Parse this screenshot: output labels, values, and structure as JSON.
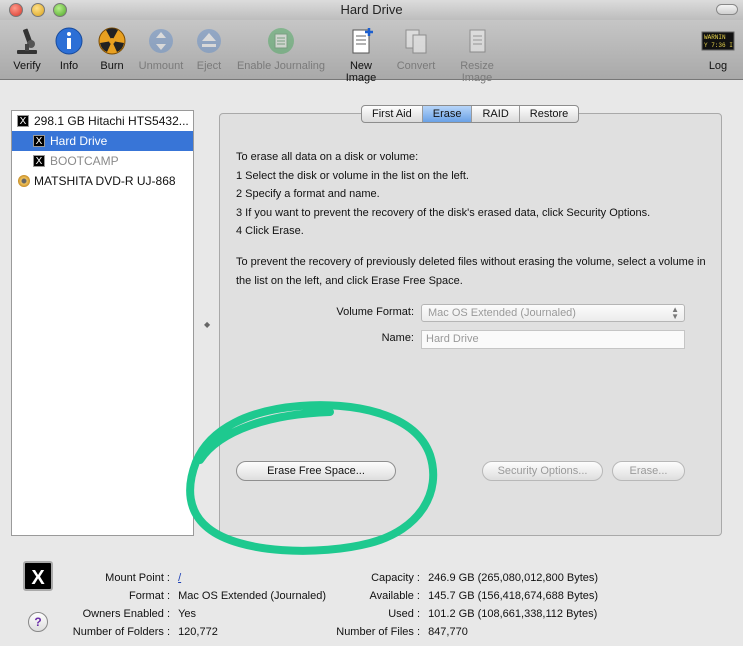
{
  "window": {
    "title": "Hard Drive"
  },
  "toolbar": {
    "items": [
      {
        "label": "Verify",
        "icon": "microscope-icon"
      },
      {
        "label": "Info",
        "icon": "info-icon"
      },
      {
        "label": "Burn",
        "icon": "burn-icon"
      },
      {
        "label": "Unmount",
        "icon": "unmount-icon"
      },
      {
        "label": "Eject",
        "icon": "eject-icon"
      },
      {
        "label": "Enable Journaling",
        "icon": "journaling-icon"
      },
      {
        "label": "New Image",
        "icon": "new-image-icon"
      },
      {
        "label": "Convert",
        "icon": "convert-icon"
      },
      {
        "label": "Resize Image",
        "icon": "resize-image-icon"
      },
      {
        "label": "Log",
        "icon": "log-icon",
        "log_text_1": "WARNIN",
        "log_text_2": "Y 7:36 I"
      }
    ]
  },
  "sidebar": {
    "items": [
      {
        "label": "298.1 GB Hitachi HTS5432...",
        "state": "normal"
      },
      {
        "label": "Hard Drive",
        "state": "selected"
      },
      {
        "label": "BOOTCAMP",
        "state": "dimmed"
      },
      {
        "label": "MATSHITA DVD-R UJ-868",
        "state": "normal"
      }
    ],
    "badge_glyph": "X"
  },
  "tabs": [
    {
      "label": "First Aid"
    },
    {
      "label": "Erase",
      "active": true
    },
    {
      "label": "RAID"
    },
    {
      "label": "Restore"
    }
  ],
  "erase": {
    "intro": "To erase all data on a disk or volume:",
    "steps": [
      "1  Select the disk or volume in the list on the left.",
      "2  Specify a format and name.",
      "3  If you want to prevent the recovery of the disk's erased data, click Security Options.",
      "4  Click Erase."
    ],
    "prevent_text": "To prevent the recovery of previously deleted files without erasing the volume, select a volume in the list on the left, and click Erase Free Space.",
    "volume_format_label": "Volume Format:",
    "volume_format_value": "Mac OS Extended (Journaled)",
    "name_label": "Name:",
    "name_value": "Hard Drive",
    "erase_free_space_button": "Erase Free Space...",
    "security_options_button": "Security Options...",
    "erase_button": "Erase..."
  },
  "annotation": {
    "color": "#1ec98f"
  },
  "info": {
    "icon_glyph": "X",
    "help_glyph": "?",
    "mount_point_label": "Mount Point :",
    "mount_point_value": "/",
    "format_label": "Format :",
    "format_value": "Mac OS Extended (Journaled)",
    "owners_label": "Owners Enabled :",
    "owners_value": "Yes",
    "folders_label": "Number of Folders :",
    "folders_value": "120,772",
    "capacity_label": "Capacity :",
    "capacity_value": "246.9 GB (265,080,012,800 Bytes)",
    "available_label": "Available :",
    "available_value": "145.7 GB (156,418,674,688 Bytes)",
    "used_label": "Used :",
    "used_value": "101.2 GB (108,661,338,112 Bytes)",
    "files_label": "Number of Files :",
    "files_value": "847,770"
  }
}
